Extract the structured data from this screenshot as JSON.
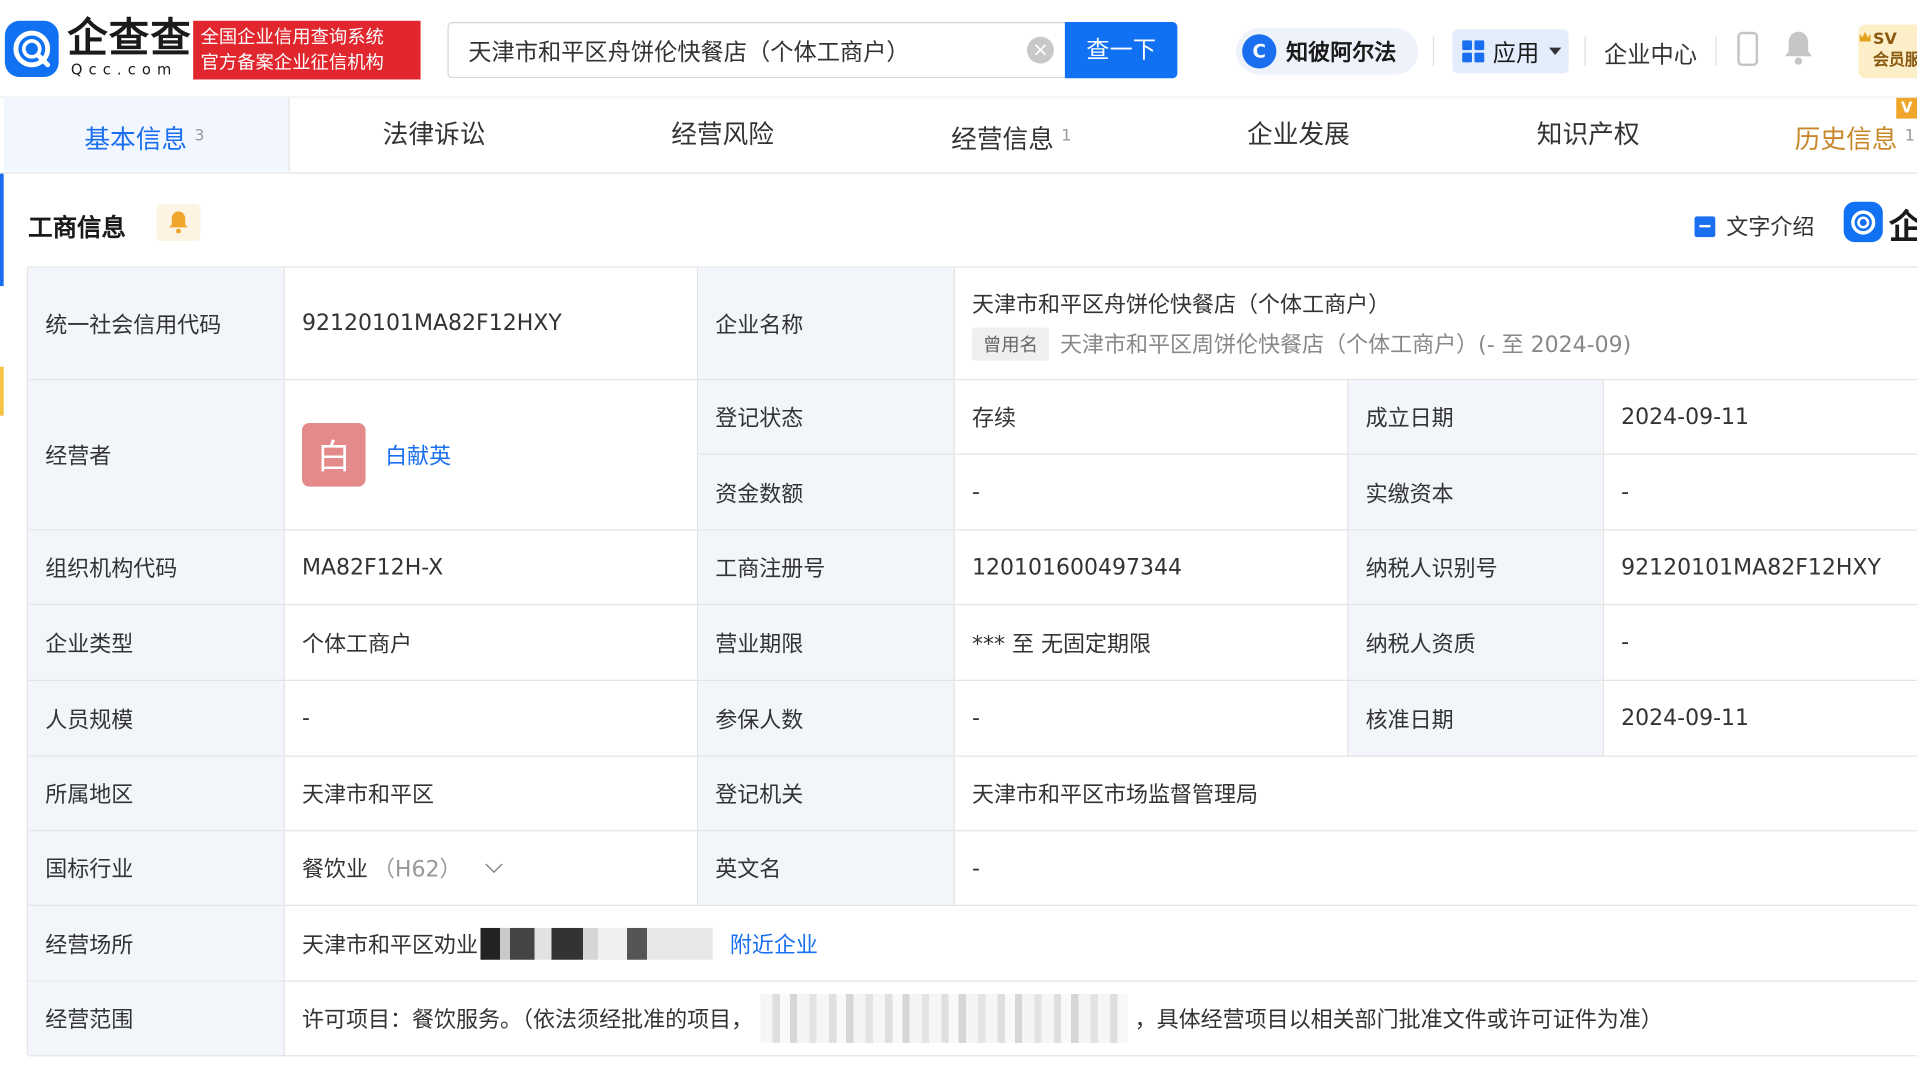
{
  "header": {
    "logo_text": "企查查",
    "logo_sub": "Qcc.com",
    "badge_line1": "全国企业信用查询系统",
    "badge_line2": "官方备案企业征信机构",
    "search_value": "天津市和平区舟饼伦快餐店（个体工商户）",
    "search_button": "查一下",
    "zhibi_label": "知彼阿尔法",
    "apps_label": "应用",
    "enterprise_center": "企业中心",
    "svip_line1": "SV",
    "svip_line2": "会员服"
  },
  "tabs": [
    {
      "label": "基本信息",
      "count": "3"
    },
    {
      "label": "法律诉讼",
      "count": ""
    },
    {
      "label": "经营风险",
      "count": ""
    },
    {
      "label": "经营信息",
      "count": "1"
    },
    {
      "label": "企业发展",
      "count": ""
    },
    {
      "label": "知识产权",
      "count": ""
    },
    {
      "label": "历史信息",
      "count": "1"
    }
  ],
  "history_tag": "V",
  "section": {
    "title": "工商信息",
    "text_intro": "文字介绍",
    "qmark_char": "企"
  },
  "table": {
    "credit_code_label": "统一社会信用代码",
    "credit_code": "92120101MA82F12HXY",
    "company_name_label": "企业名称",
    "company_name": "天津市和平区舟饼伦快餐店（个体工商户）",
    "former_tag": "曾用名",
    "former_name": "天津市和平区周饼伦快餐店（个体工商户）(- 至 2024-09)",
    "operator_label": "经营者",
    "operator_avatar": "白",
    "operator_name": "白献英",
    "reg_status_label": "登记状态",
    "reg_status": "存续",
    "founded_label": "成立日期",
    "founded": "2024-09-11",
    "capital_label": "资金数额",
    "capital": "-",
    "paid_capital_label": "实缴资本",
    "paid_capital": "-",
    "org_code_label": "组织机构代码",
    "org_code": "MA82F12H-X",
    "biz_reg_no_label": "工商注册号",
    "biz_reg_no": "120101600497344",
    "taxpayer_id_label": "纳税人识别号",
    "taxpayer_id": "92120101MA82F12HXY",
    "type_label": "企业类型",
    "type": "个体工商户",
    "term_label": "营业期限",
    "term": "*** 至 无固定期限",
    "tax_qual_label": "纳税人资质",
    "tax_qual": "-",
    "staff_label": "人员规模",
    "staff": "-",
    "insured_label": "参保人数",
    "insured": "-",
    "approved_label": "核准日期",
    "approved": "2024-09-11",
    "region_label": "所属地区",
    "region": "天津市和平区",
    "authority_label": "登记机关",
    "authority": "天津市和平区市场监督管理局",
    "industry_label": "国标行业",
    "industry": "餐饮业",
    "industry_code": "（H62）",
    "en_name_label": "英文名",
    "en_name": "-",
    "address_label": "经营场所",
    "address": "天津市和平区劝业",
    "nearby": "附近企业",
    "scope_label": "经营范围",
    "scope_start": "许可项目：餐饮服务。（依法须经批准的项目，",
    "scope_end": "，具体经营项目以相关部门批准文件或许可证件为准）"
  }
}
